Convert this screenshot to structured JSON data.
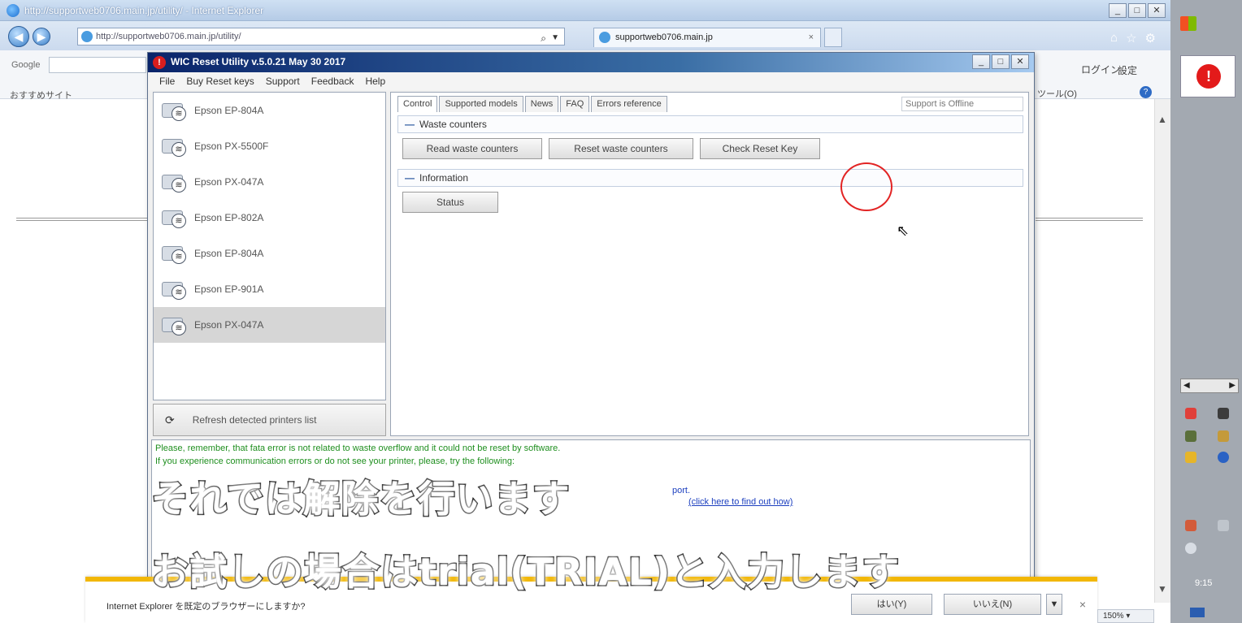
{
  "browser": {
    "title": "http://supportweb0706.main.jp/utility/ - Internet Explorer",
    "url": "http://supportweb0706.main.jp/utility/",
    "tab_title": "supportweb0706.main.jp",
    "search_provider": "Google",
    "favorites_label": "おすすめサイト",
    "login_label": "ログイン",
    "settings_label": "設定",
    "tools_label": "ツール(O)",
    "zoom": "150%"
  },
  "wic": {
    "title": "WIC Reset Utility v.5.0.21 May 30 2017",
    "menu": [
      "File",
      "Buy Reset keys",
      "Support",
      "Feedback",
      "Help"
    ],
    "printers": [
      {
        "name": "Epson EP-804A",
        "selected": false
      },
      {
        "name": "Epson PX-5500F",
        "selected": false
      },
      {
        "name": "Epson PX-047A",
        "selected": false
      },
      {
        "name": "Epson EP-802A",
        "selected": false
      },
      {
        "name": "Epson EP-804A",
        "selected": false
      },
      {
        "name": "Epson EP-901A",
        "selected": false
      },
      {
        "name": "Epson PX-047A",
        "selected": true
      }
    ],
    "refresh_label": "Refresh detected printers list",
    "tabs": [
      "Control",
      "Supported models",
      "News",
      "FAQ",
      "Errors reference"
    ],
    "support_online": "Support is Offline",
    "waste_header": "Waste counters",
    "buttons": {
      "read": "Read waste counters",
      "reset": "Reset waste counters",
      "check": "Check Reset Key",
      "status": "Status"
    },
    "info_header": "Information",
    "info_lines": [
      "Please, remember, that fata error is not related to waste overflow and it could not be reset by software.",
      "If you experience communication errors or do not see your printer, please, try the following:",
      "port.",
      "(click here to find out how)"
    ]
  },
  "notify": {
    "text": "Internet Explorer を既定のブラウザーにしますか?",
    "yes": "はい(Y)",
    "no": "いいえ(N)"
  },
  "subtitles": {
    "line1": "それでは解除を行います",
    "line2": "お試しの場合はtrial(TRIAL)と入力します"
  },
  "desktop": {
    "time": "9:15"
  },
  "colors": {
    "wic_title_start": "#0a246a",
    "accent_red": "#e22424",
    "info_green": "#1f8f1f",
    "notify_yellow": "#f2b705"
  }
}
